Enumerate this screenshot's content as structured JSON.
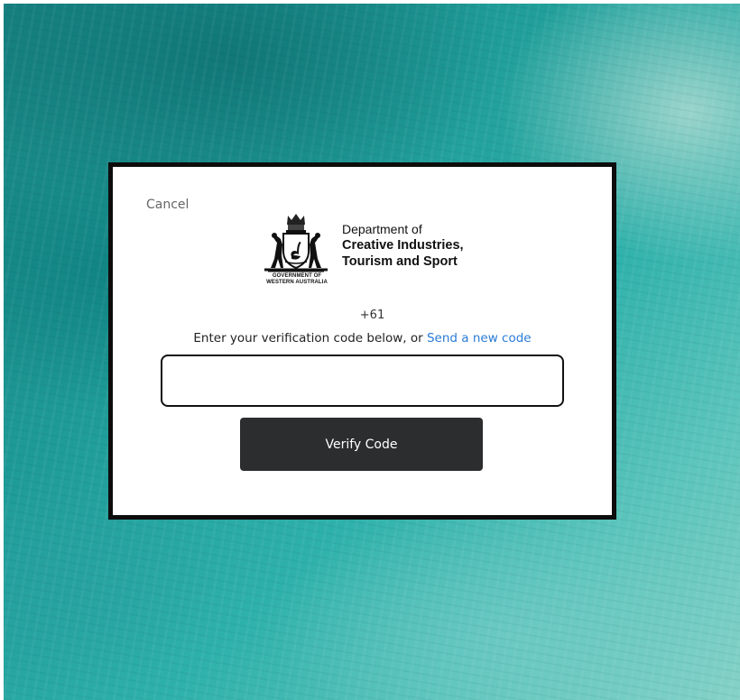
{
  "dialog": {
    "cancel_label": "Cancel",
    "logo": {
      "crest_name": "Western Australia coat of arms",
      "gov_line1": "GOVERNMENT OF",
      "gov_line2": "WESTERN AUSTRALIA",
      "dept_line1": "Department of",
      "dept_line2": "Creative Industries,",
      "dept_line3": "Tourism and Sport"
    },
    "phone_prefix": "+61",
    "instruction_text": "Enter your verification code below, or ",
    "resend_link": "Send a new code",
    "code_input": {
      "value": "",
      "placeholder": ""
    },
    "verify_button_label": "Verify Code"
  },
  "colors": {
    "link": "#2a7bd6",
    "button_bg": "#2c2d2f",
    "background_teal": "#1f9c98"
  }
}
